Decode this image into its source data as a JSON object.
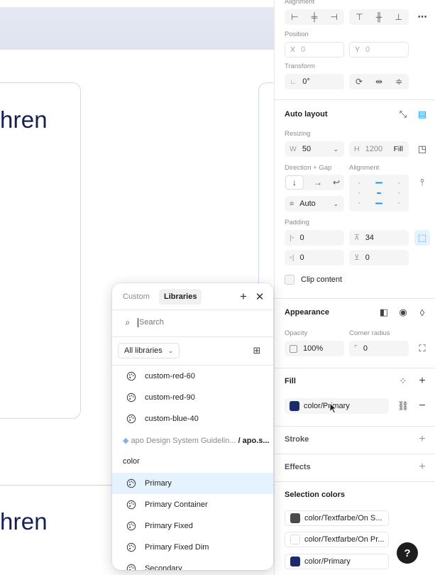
{
  "canvas": {
    "word_top": "hren",
    "word_bottom": "hren"
  },
  "panel": {
    "alignment": {
      "title": "Alignment"
    },
    "position": {
      "title": "Position",
      "x_prefix": "X",
      "x_value": "0",
      "y_prefix": "Y",
      "y_value": "0"
    },
    "transform": {
      "title": "Transform",
      "rotation": "0°"
    },
    "auto_layout": {
      "title": "Auto layout",
      "resizing_label": "Resizing",
      "w_prefix": "W",
      "w_value": "50",
      "h_prefix": "H",
      "h_value": "1200",
      "h_mode": "Fill",
      "direction_label": "Direction + Gap",
      "alignment_label": "Alignment",
      "gap_value": "Auto",
      "padding_label": "Padding",
      "pad_left": "0",
      "pad_top": "34",
      "pad_right": "0",
      "pad_bottom": "0",
      "clip_content": "Clip content"
    },
    "appearance": {
      "title": "Appearance",
      "opacity_label": "Opacity",
      "opacity_value": "100%",
      "radius_label": "Corner radius",
      "radius_value": "0"
    },
    "fill": {
      "title": "Fill",
      "style_name": "color/Primary",
      "swatch": "#1b2a6b"
    },
    "stroke": {
      "title": "Stroke"
    },
    "effects": {
      "title": "Effects"
    },
    "selection_colors": {
      "title": "Selection colors",
      "items": [
        {
          "name": "color/Textfarbe/On S...",
          "swatch": "#4a4a4a"
        },
        {
          "name": "color/Textfarbe/On Pr...",
          "swatch": "#ffffff"
        },
        {
          "name": "color/Primary",
          "swatch": "#1b2a6b"
        }
      ]
    },
    "help": "?"
  },
  "popup": {
    "tabs": [
      "Custom",
      "Libraries"
    ],
    "search_placeholder": "Search",
    "filter_label": "All libraries",
    "items_top": [
      "custom-red-60",
      "custom-red-90",
      "custom-blue-40"
    ],
    "library_path": "apo Design System Guidelin...",
    "library_suffix": "/ apo.s...",
    "group_label": "color",
    "items_color": [
      "Primary",
      "Primary Container",
      "Primary Fixed",
      "Primary Fixed Dim",
      "Secondary"
    ]
  },
  "colors": {
    "accent": "#0d99ff",
    "primary_swatch": "#1b2a6b",
    "selected_row": "#e5f2ff"
  }
}
